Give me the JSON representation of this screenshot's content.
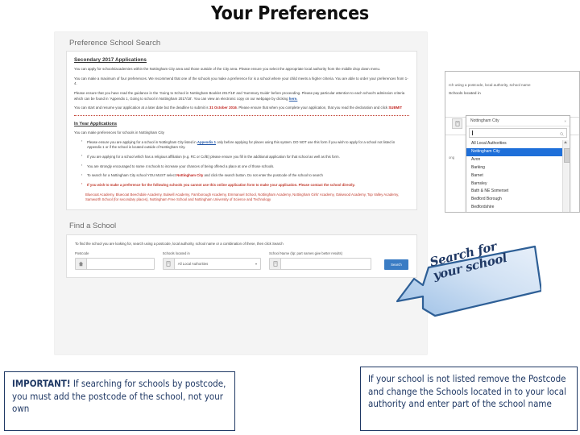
{
  "slide": {
    "title": "Your Preferences"
  },
  "screenshot": {
    "panel_heading": "Preference School Search",
    "section_heading": "Secondary 2017 Applications",
    "paragraphs": [
      "You can apply for schools/academies within the Nottingham City area and those outside of the City area. Please ensure you select the appropriate local authority from the middle drop down menu.",
      "You can make a maximum of four preferences. We recommend that one of the schools you make a preference for is a school where your child meets a higher criteria. You are able to order your preferences from 1-4."
    ],
    "paragraph3_part1": "Please ensure that you have read the guidance in the 'Going to School in Nottingham Booklet 2017/18' and 'Summary Guide' before proceeding. Please pay particular attention to each school's admission criteria which can be found in 'Appendix 1, Going to school in Nottingham 2017/18'. You can view an electronic copy on our webpage by clicking ",
    "paragraph3_link": "here.",
    "paragraph4_part1": "You can start and resume your application at a later date but the deadline to submit is ",
    "paragraph4_deadline": "31 October 2016",
    "paragraph4_part2": ". Please ensure that when you complete your application, that you read the declaration and click ",
    "paragraph4_submit": "SUBMIT",
    "in_year_heading": "In Year Applications",
    "in_year_intro": "You can make preferences for schools in Nottingham City",
    "bullets": [
      {
        "text_before": "Please ensure you are applying for a school in Nottingham City listed in ",
        "link": "Appendix 1",
        "text_after": " only before applying for places using this system. DO NOT use this form if you wish to apply for a school not listed in Appendix 1 or if the school is located outside of Nottingham City.",
        "style": "normal"
      },
      {
        "text_before": "If you are applying for a school which has a religious affiliation (e.g. RC or CofE) please ensure you fill in the additional application for that school as well as this form.",
        "link": "",
        "text_after": "",
        "style": "normal"
      },
      {
        "text_before": "You are strongly encouraged to name 4 schools to increase your chances of being offered a place at one of those schools.",
        "link": "",
        "text_after": "",
        "style": "normal"
      },
      {
        "text_before": "To search for a Nottingham City school YOU MUST select ",
        "link": "",
        "highlight": "Nottingham City",
        "text_after": " and click the search button. Do not enter the postcode of the school to search",
        "style": "highlight"
      },
      {
        "text_before": "If you wish to make a preference for the following schools you cannot use this online application form to make your application. Please contact the school directly.",
        "link": "",
        "text_after": "",
        "style": "red"
      }
    ],
    "school_list": "Bluecoat Academy, Bluecoat Beechdale Academy, Bulwell Academy, Farnborough Academy, Emmanuel School, Nottingham Academy, Nottingham Girls' Academy, Oakwood Academy, Top Valley Academy, Samworth School (for secondary places), Nottingham Free School and Nottingham University of Science and Technology",
    "find_heading": "Find a School",
    "find_intro": "To find the school you are looking for, search using a postcode, local authority, school name or a combination of these, then click Search",
    "fields": [
      {
        "label": "Postcode",
        "value": "",
        "icon": "home-icon"
      },
      {
        "label": "Schools located in",
        "value": "All Local Authorities",
        "icon": "building-icon"
      },
      {
        "label": "School Name (tip: part names give better results)",
        "value": "",
        "icon": "building-icon"
      }
    ],
    "search_button": "Search"
  },
  "inset": {
    "top_text": "rch using a postcode, local authority, school name",
    "label": "Schools located in",
    "selected": "Nottingham City",
    "close_glyph": "×",
    "search_value": "",
    "side_text": "ong",
    "options": [
      "All Local Authorities",
      "Nottingham City",
      "Avon",
      "Barking",
      "Barnet",
      "Barnsley",
      "Bath & NE Somerset",
      "Bedford Borough",
      "Bedfordshire"
    ],
    "selected_index": 1
  },
  "callout": {
    "line1": "Search for",
    "line2": "your school",
    "fill_start": "#dce8f7",
    "fill_end": "#a8c6e8",
    "stroke": "#2e5f96"
  },
  "notes": {
    "left_bold": "IMPORTANT!",
    "left_rest": " If searching for schools by postcode, you must add the postcode of the school, not your own",
    "right": "If your school is not listed remove the Postcode and change the Schools located in to your local authority and enter part of the school name",
    "border_color": "#1f3864"
  }
}
